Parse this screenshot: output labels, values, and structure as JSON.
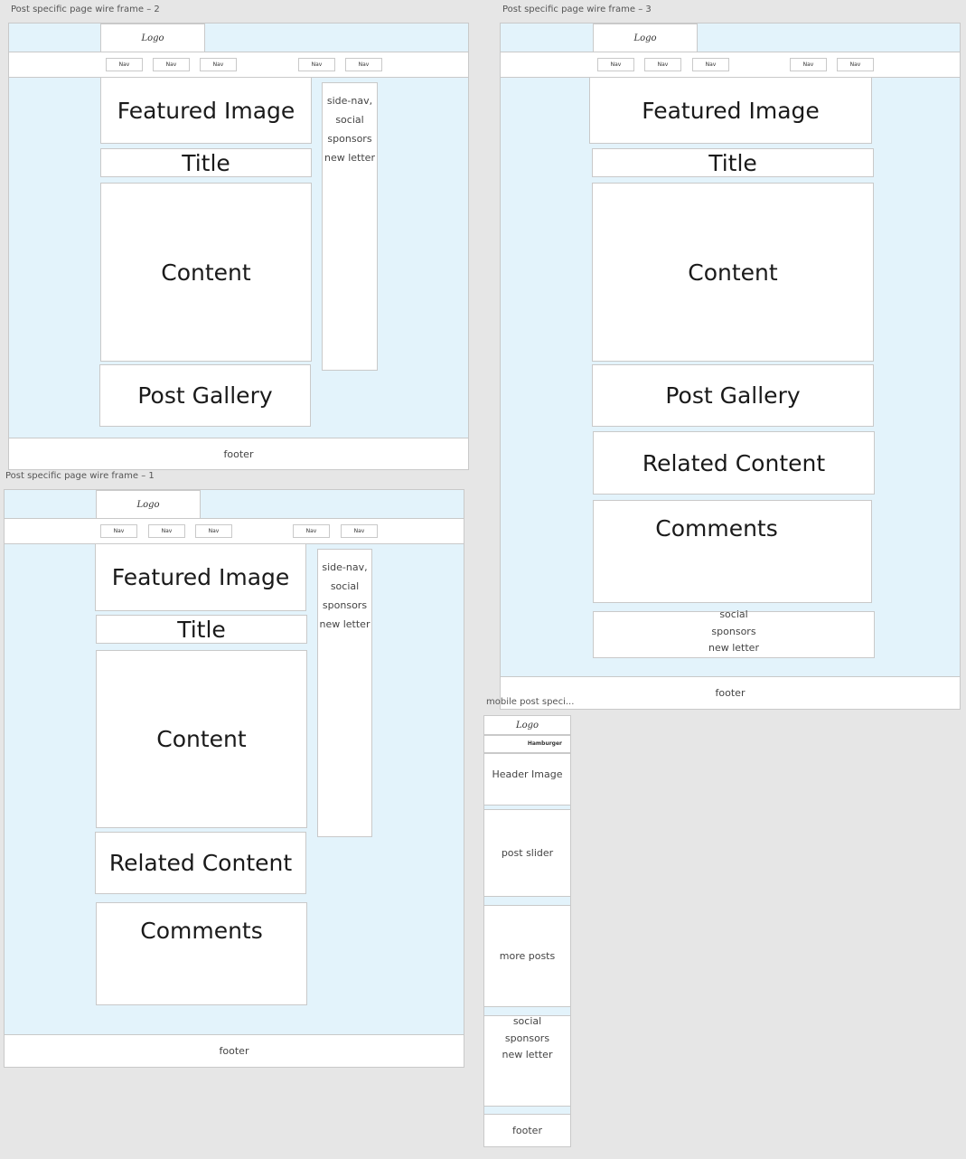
{
  "frames": {
    "wf2": {
      "label": "Post specific page wire frame – 2"
    },
    "wf3": {
      "label": "Post specific page wire frame – 3"
    },
    "wf1": {
      "label": "Post specific page wire frame – 1"
    },
    "mobile": {
      "label": "mobile post speci..."
    }
  },
  "common": {
    "logo": "Logo",
    "nav": "Nav",
    "featured_image": "Featured Image",
    "title": "Title",
    "content": "Content",
    "post_gallery": "Post Gallery",
    "related_content": "Related Content",
    "comments": "Comments",
    "footer": "footer",
    "sidebar": [
      "side-nav,",
      "social",
      "sponsors",
      "new letter"
    ],
    "bottom_widgets": [
      "social",
      "sponsors",
      "new letter"
    ]
  },
  "mobile": {
    "logo": "Logo",
    "hamburger": "Hamburger",
    "header_image": "Header Image",
    "post_slider": "post slider",
    "more_posts": "more posts",
    "widgets": [
      "social",
      "sponsors",
      "new letter"
    ],
    "footer": "footer"
  }
}
